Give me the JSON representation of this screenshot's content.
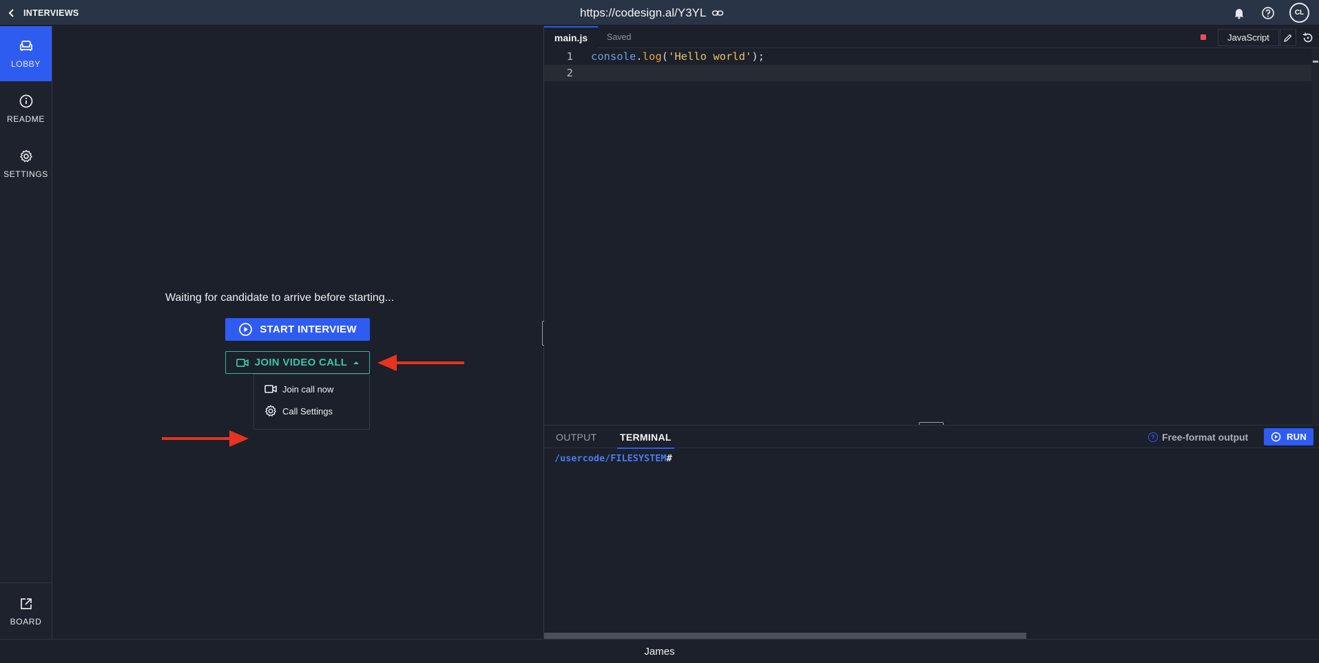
{
  "topbar": {
    "back_label": "INTERVIEWS",
    "url": "https://codesign.al/Y3YL",
    "avatar_initials": "CL"
  },
  "sidebar": {
    "items": [
      {
        "label": "LOBBY",
        "icon": "sofa-icon",
        "active": true
      },
      {
        "label": "README",
        "icon": "info-icon",
        "active": false
      },
      {
        "label": "SETTINGS",
        "icon": "gear-icon",
        "active": false
      }
    ],
    "bottom_item": {
      "label": "BOARD",
      "icon": "external-link-icon"
    }
  },
  "lobby": {
    "waiting_text": "Waiting for candidate to arrive before starting...",
    "start_label": "START INTERVIEW",
    "video_label": "JOIN VIDEO CALL",
    "dropdown": [
      {
        "label": "Join call now",
        "icon": "video-camera-icon"
      },
      {
        "label": "Call Settings",
        "icon": "gear-icon"
      }
    ]
  },
  "editor": {
    "tab_label": "main.js",
    "status": "Saved",
    "language": "JavaScript",
    "lines": [
      {
        "num": "1",
        "tokens": [
          {
            "t": "console",
            "c": "tok-obj"
          },
          {
            "t": ".",
            "c": "tok-punc"
          },
          {
            "t": "log",
            "c": "tok-fn"
          },
          {
            "t": "(",
            "c": "tok-punc"
          },
          {
            "t": "'Hello world'",
            "c": "tok-str"
          },
          {
            "t": ");",
            "c": "tok-punc"
          }
        ]
      },
      {
        "num": "2",
        "tokens": []
      }
    ]
  },
  "bottom_panel": {
    "tabs": [
      "OUTPUT",
      "TERMINAL"
    ],
    "active_tab": "TERMINAL",
    "free_format_label": "Free-format output",
    "run_label": "RUN",
    "prompt_path": "/usercode/FILESYSTEM",
    "prompt_symbol": "#"
  },
  "footer": {
    "participant_name": "James"
  },
  "colors": {
    "accent_blue": "#2e5bf2",
    "video_green": "#3ec3a8",
    "annotation_red": "#e8331f"
  }
}
